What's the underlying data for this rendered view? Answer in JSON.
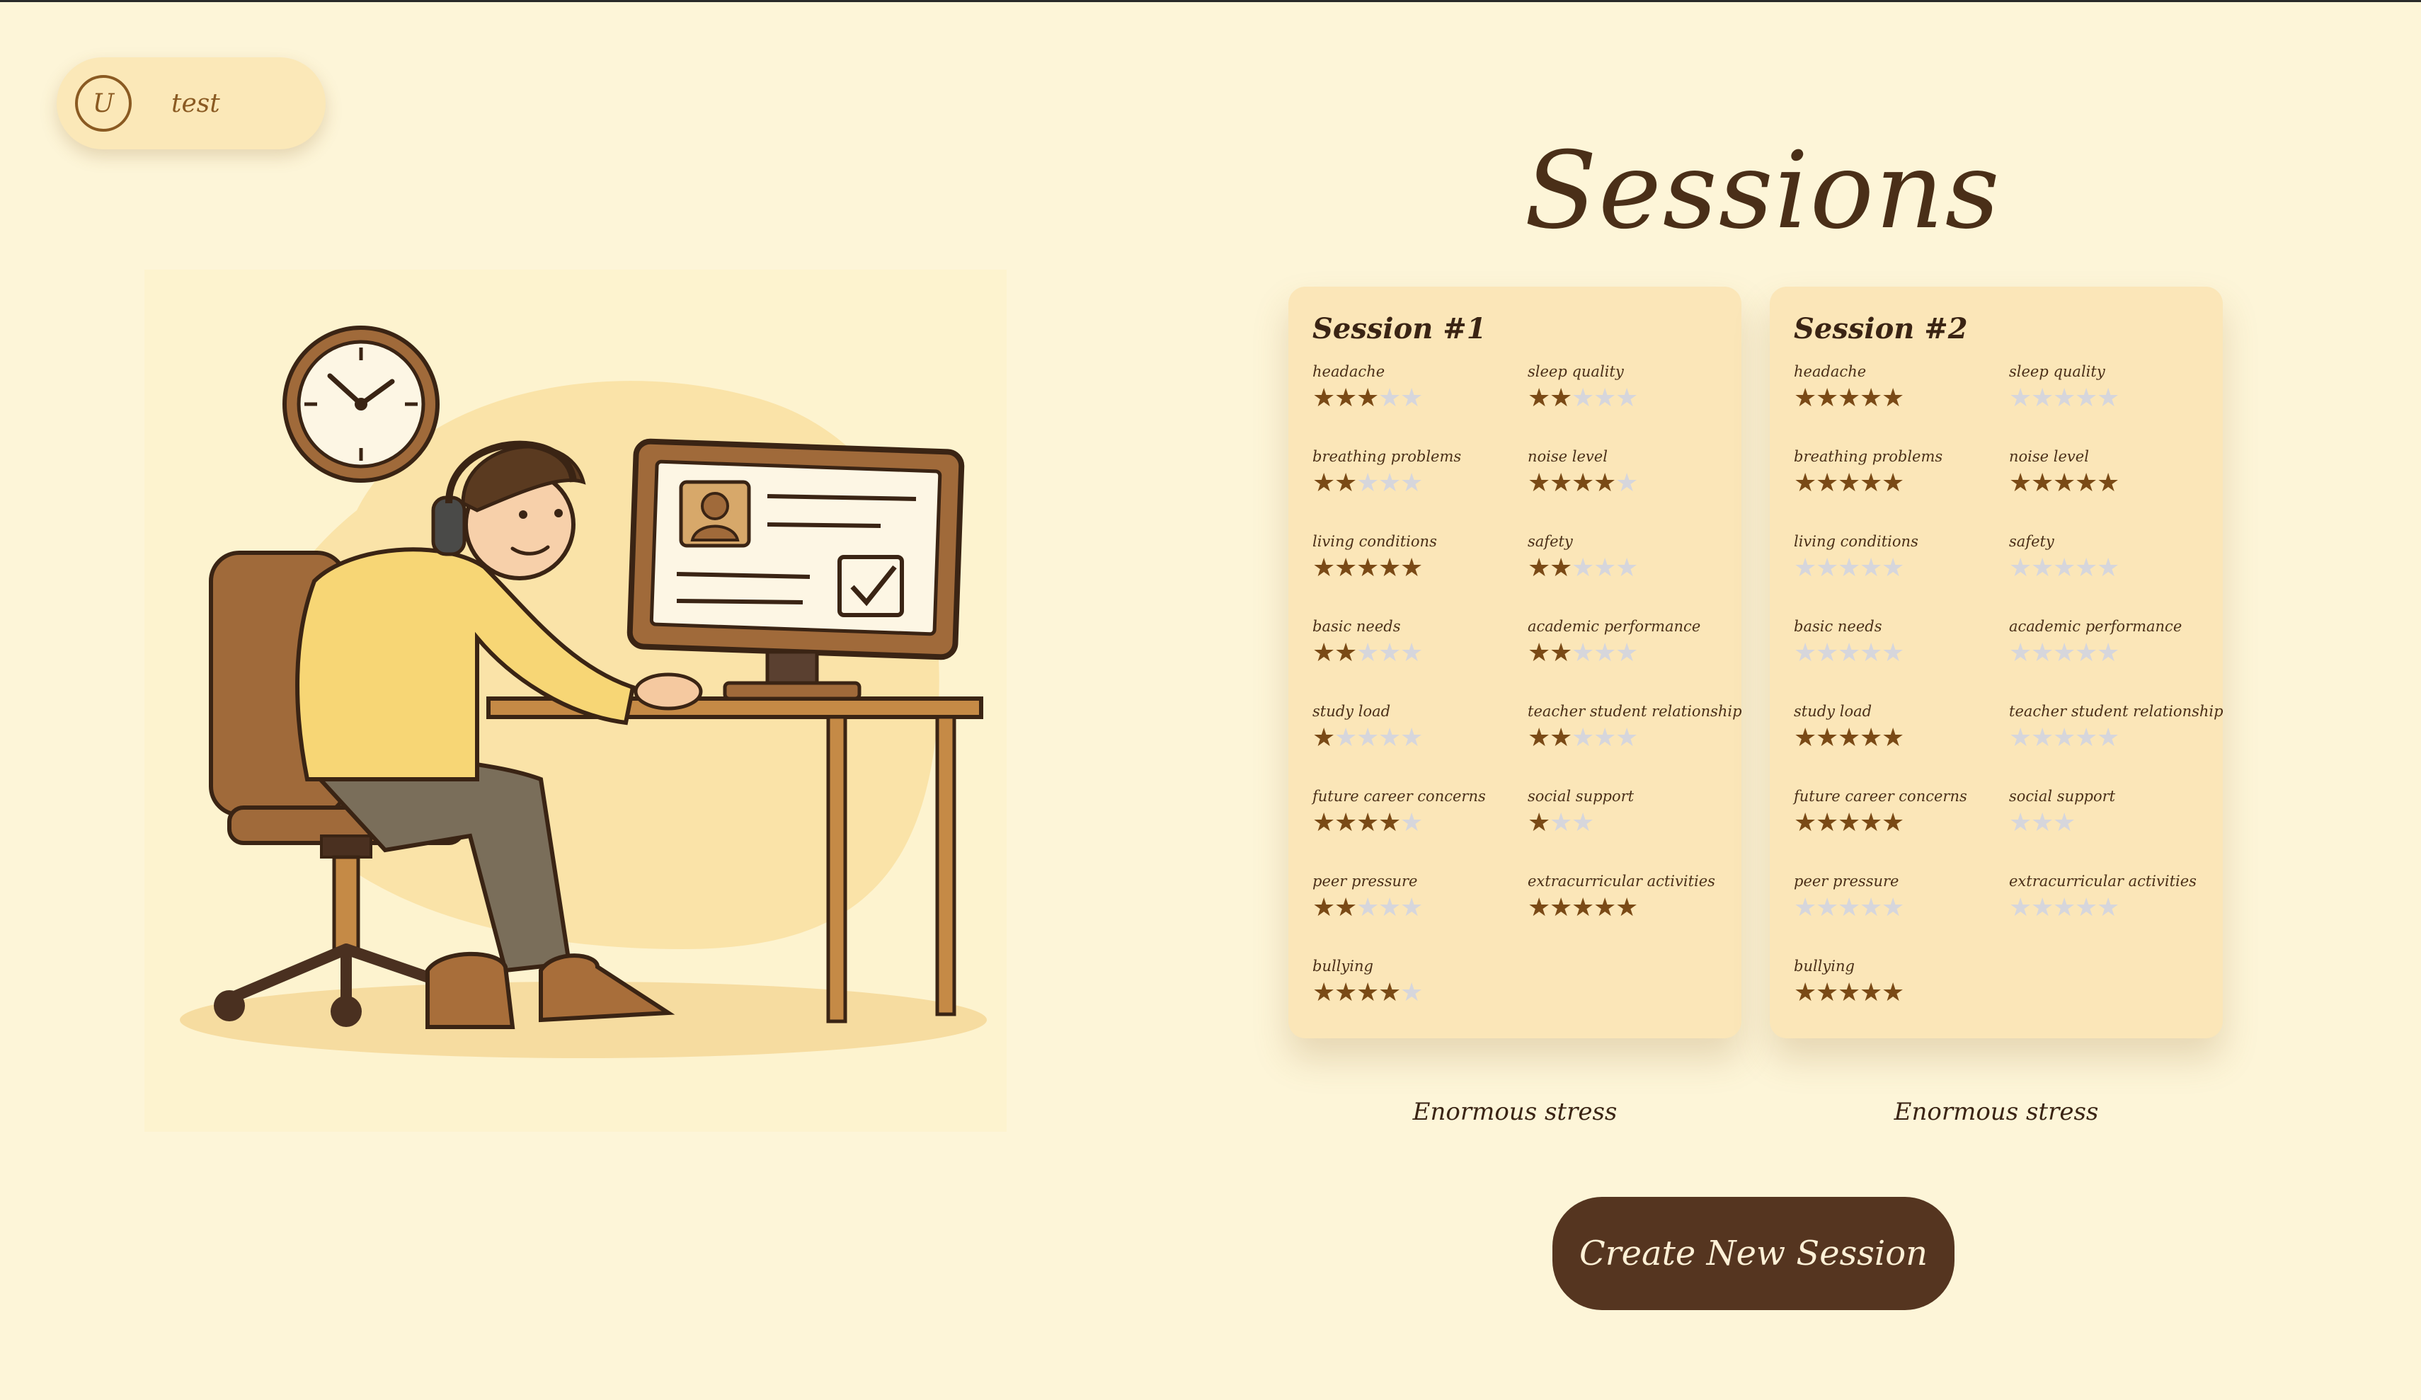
{
  "user": {
    "initial": "U",
    "name": "test"
  },
  "page_title": "Sessions",
  "sessions": [
    {
      "title": "Session #1",
      "summary": "Enormous stress",
      "metrics": [
        {
          "label": "headache",
          "rating": 3,
          "max": 5
        },
        {
          "label": "sleep quality",
          "rating": 2,
          "max": 5
        },
        {
          "label": "breathing problems",
          "rating": 2,
          "max": 5
        },
        {
          "label": "noise level",
          "rating": 4,
          "max": 5
        },
        {
          "label": "living conditions",
          "rating": 5,
          "max": 5
        },
        {
          "label": "safety",
          "rating": 2,
          "max": 5
        },
        {
          "label": "basic needs",
          "rating": 2,
          "max": 5
        },
        {
          "label": "academic performance",
          "rating": 2,
          "max": 5
        },
        {
          "label": "study load",
          "rating": 1,
          "max": 5
        },
        {
          "label": "teacher student relationship",
          "rating": 2,
          "max": 5
        },
        {
          "label": "future career concerns",
          "rating": 4,
          "max": 5
        },
        {
          "label": "social support",
          "rating": 1,
          "max": 3
        },
        {
          "label": "peer pressure",
          "rating": 2,
          "max": 5
        },
        {
          "label": "extracurricular activities",
          "rating": 5,
          "max": 5
        },
        {
          "label": "bullying",
          "rating": 4,
          "max": 5
        }
      ]
    },
    {
      "title": "Session #2",
      "summary": "Enormous stress",
      "metrics": [
        {
          "label": "headache",
          "rating": 5,
          "max": 5
        },
        {
          "label": "sleep quality",
          "rating": 0,
          "max": 5
        },
        {
          "label": "breathing problems",
          "rating": 5,
          "max": 5
        },
        {
          "label": "noise level",
          "rating": 5,
          "max": 5
        },
        {
          "label": "living conditions",
          "rating": 0,
          "max": 5
        },
        {
          "label": "safety",
          "rating": 0,
          "max": 5
        },
        {
          "label": "basic needs",
          "rating": 0,
          "max": 5
        },
        {
          "label": "academic performance",
          "rating": 0,
          "max": 5
        },
        {
          "label": "study load",
          "rating": 5,
          "max": 5
        },
        {
          "label": "teacher student relationship",
          "rating": 0,
          "max": 5
        },
        {
          "label": "future career concerns",
          "rating": 5,
          "max": 5
        },
        {
          "label": "social support",
          "rating": 0,
          "max": 3
        },
        {
          "label": "peer pressure",
          "rating": 0,
          "max": 5
        },
        {
          "label": "extracurricular activities",
          "rating": 0,
          "max": 5
        },
        {
          "label": "bullying",
          "rating": 5,
          "max": 5
        }
      ]
    }
  ],
  "create_button_label": "Create New Session",
  "colors": {
    "background": "#fdf5d8",
    "card": "#fbe6b8",
    "star_filled": "#7a4a16",
    "star_empty": "#d6d6dc",
    "button": "#553520"
  }
}
